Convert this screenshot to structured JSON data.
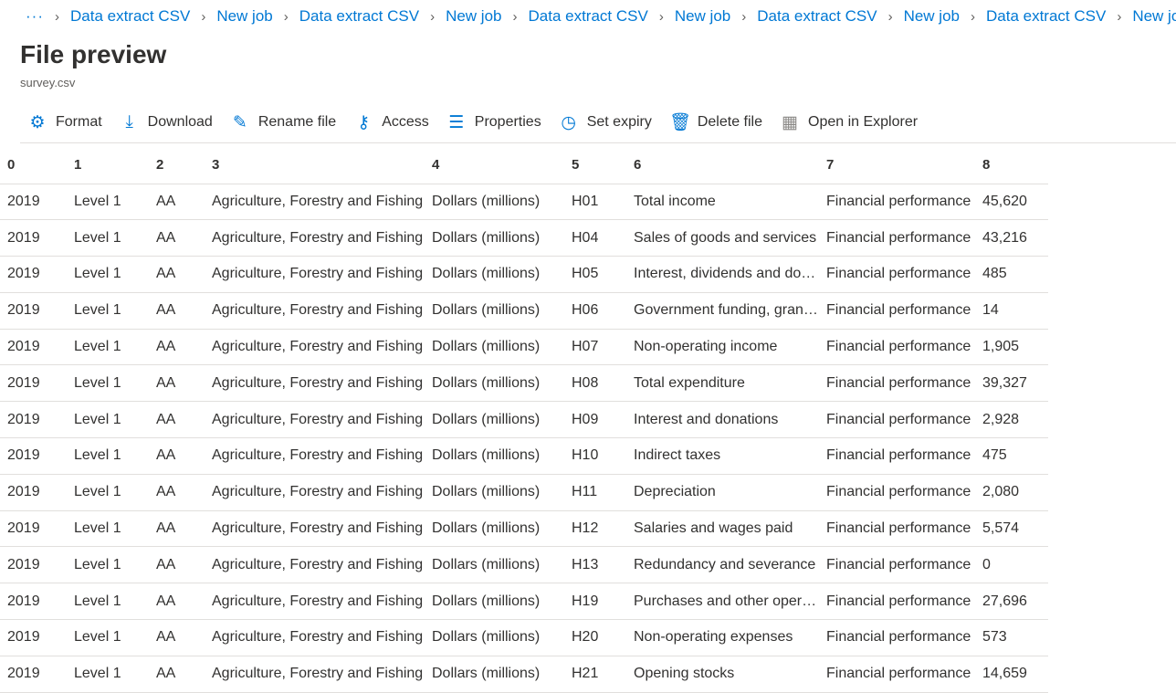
{
  "breadcrumb": {
    "overflow": "···",
    "items": [
      "Data extract CSV",
      "New job",
      "Data extract CSV",
      "New job",
      "Data extract CSV",
      "New job",
      "Data extract CSV",
      "New job",
      "Data extract CSV",
      "New job"
    ]
  },
  "title": "File preview",
  "subtitle": "survey.csv",
  "toolbar": [
    {
      "label": "Format",
      "icon": "gear-icon",
      "glyph": "⚙"
    },
    {
      "label": "Download",
      "icon": "download-icon",
      "glyph": "⤓"
    },
    {
      "label": "Rename file",
      "icon": "pencil-icon",
      "glyph": "✎"
    },
    {
      "label": "Access",
      "icon": "key-icon",
      "glyph": "⚷"
    },
    {
      "label": "Properties",
      "icon": "sliders-icon",
      "glyph": "☰"
    },
    {
      "label": "Set expiry",
      "icon": "clock-icon",
      "glyph": "◷"
    },
    {
      "label": "Delete file",
      "icon": "trash-icon",
      "glyph": "🗑"
    },
    {
      "label": "Open in Explorer",
      "icon": "explorer-icon",
      "glyph": "▦"
    }
  ],
  "table": {
    "headers": [
      "0",
      "1",
      "2",
      "3",
      "4",
      "5",
      "6",
      "7",
      "8"
    ],
    "rows": [
      [
        "2019",
        "Level 1",
        "AA",
        "Agriculture, Forestry and Fishing",
        "Dollars (millions)",
        "H01",
        "Total income",
        "Financial performance",
        "45,620"
      ],
      [
        "2019",
        "Level 1",
        "AA",
        "Agriculture, Forestry and Fishing",
        "Dollars (millions)",
        "H04",
        "Sales of goods and services",
        "Financial performance",
        "43,216"
      ],
      [
        "2019",
        "Level 1",
        "AA",
        "Agriculture, Forestry and Fishing",
        "Dollars (millions)",
        "H05",
        "Interest, dividends and donations",
        "Financial performance",
        "485"
      ],
      [
        "2019",
        "Level 1",
        "AA",
        "Agriculture, Forestry and Fishing",
        "Dollars (millions)",
        "H06",
        "Government funding, grants and subsidies",
        "Financial performance",
        "14"
      ],
      [
        "2019",
        "Level 1",
        "AA",
        "Agriculture, Forestry and Fishing",
        "Dollars (millions)",
        "H07",
        "Non-operating income",
        "Financial performance",
        "1,905"
      ],
      [
        "2019",
        "Level 1",
        "AA",
        "Agriculture, Forestry and Fishing",
        "Dollars (millions)",
        "H08",
        "Total expenditure",
        "Financial performance",
        "39,327"
      ],
      [
        "2019",
        "Level 1",
        "AA",
        "Agriculture, Forestry and Fishing",
        "Dollars (millions)",
        "H09",
        "Interest and donations",
        "Financial performance",
        "2,928"
      ],
      [
        "2019",
        "Level 1",
        "AA",
        "Agriculture, Forestry and Fishing",
        "Dollars (millions)",
        "H10",
        "Indirect taxes",
        "Financial performance",
        "475"
      ],
      [
        "2019",
        "Level 1",
        "AA",
        "Agriculture, Forestry and Fishing",
        "Dollars (millions)",
        "H11",
        "Depreciation",
        "Financial performance",
        "2,080"
      ],
      [
        "2019",
        "Level 1",
        "AA",
        "Agriculture, Forestry and Fishing",
        "Dollars (millions)",
        "H12",
        "Salaries and wages paid",
        "Financial performance",
        "5,574"
      ],
      [
        "2019",
        "Level 1",
        "AA",
        "Agriculture, Forestry and Fishing",
        "Dollars (millions)",
        "H13",
        "Redundancy and severance",
        "Financial performance",
        "0"
      ],
      [
        "2019",
        "Level 1",
        "AA",
        "Agriculture, Forestry and Fishing",
        "Dollars (millions)",
        "H19",
        "Purchases and other operating expenses",
        "Financial performance",
        "27,696"
      ],
      [
        "2019",
        "Level 1",
        "AA",
        "Agriculture, Forestry and Fishing",
        "Dollars (millions)",
        "H20",
        "Non-operating expenses",
        "Financial performance",
        "573"
      ],
      [
        "2019",
        "Level 1",
        "AA",
        "Agriculture, Forestry and Fishing",
        "Dollars (millions)",
        "H21",
        "Opening stocks",
        "Financial performance",
        "14,659"
      ]
    ]
  }
}
